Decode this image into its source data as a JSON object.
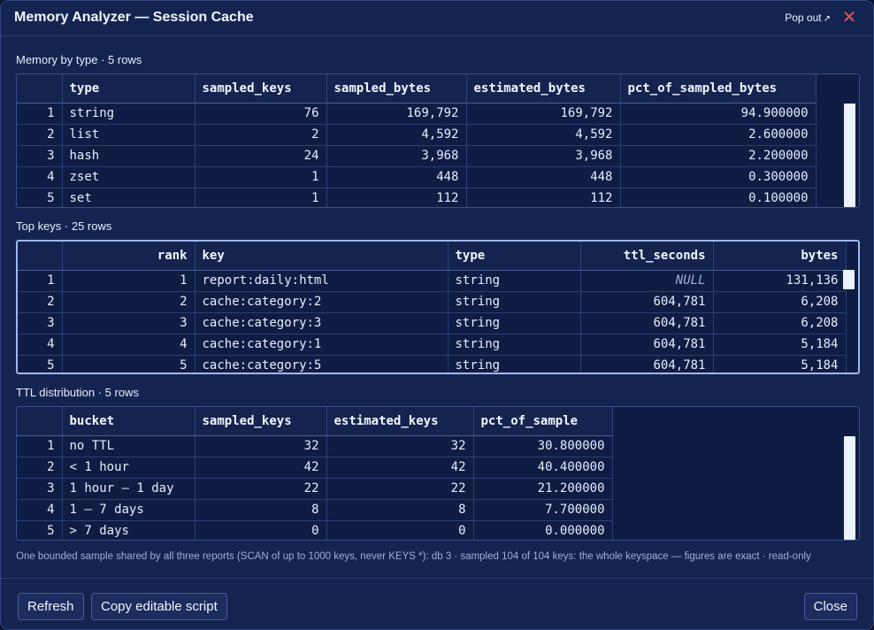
{
  "window": {
    "title": "Memory Analyzer — Session Cache",
    "popout_label": "Pop out",
    "popout_icon": "↗",
    "close_icon": "✕"
  },
  "memory_by_type": {
    "label": "Memory by type · 5 rows",
    "columns": [
      "",
      "type",
      "sampled_keys",
      "sampled_bytes",
      "estimated_bytes",
      "pct_of_sampled_bytes"
    ],
    "rows": [
      [
        "1",
        "string",
        "76",
        "169,792",
        "169,792",
        "94.900000"
      ],
      [
        "2",
        "list",
        "2",
        "4,592",
        "4,592",
        "2.600000"
      ],
      [
        "3",
        "hash",
        "24",
        "3,968",
        "3,968",
        "2.200000"
      ],
      [
        "4",
        "zset",
        "1",
        "448",
        "448",
        "0.300000"
      ],
      [
        "5",
        "set",
        "1",
        "112",
        "112",
        "0.100000"
      ]
    ]
  },
  "top_keys": {
    "label": "Top keys · 25 rows",
    "columns": [
      "",
      "rank",
      "key",
      "type",
      "ttl_seconds",
      "bytes"
    ],
    "rows": [
      [
        "1",
        "1",
        "report:daily:html",
        "string",
        "NULL",
        "131,136"
      ],
      [
        "2",
        "2",
        "cache:category:2",
        "string",
        "604,781",
        "6,208"
      ],
      [
        "3",
        "3",
        "cache:category:3",
        "string",
        "604,781",
        "6,208"
      ],
      [
        "4",
        "4",
        "cache:category:1",
        "string",
        "604,781",
        "5,184"
      ],
      [
        "5",
        "5",
        "cache:category:5",
        "string",
        "604,781",
        "5,184"
      ]
    ]
  },
  "ttl_distribution": {
    "label": "TTL distribution · 5 rows",
    "columns": [
      "",
      "bucket",
      "sampled_keys",
      "estimated_keys",
      "pct_of_sample"
    ],
    "rows": [
      [
        "1",
        "no TTL",
        "32",
        "32",
        "30.800000"
      ],
      [
        "2",
        "< 1 hour",
        "42",
        "42",
        "40.400000"
      ],
      [
        "3",
        "1 hour – 1 day",
        "22",
        "22",
        "21.200000"
      ],
      [
        "4",
        "1 – 7 days",
        "8",
        "8",
        "7.700000"
      ],
      [
        "5",
        "> 7 days",
        "0",
        "0",
        "0.000000"
      ]
    ]
  },
  "footer_note": "One bounded sample shared by all three reports (SCAN of up to 1000 keys, never KEYS *): db 3 · sampled 104 of 104 keys: the whole keyspace — figures are exact · read-only",
  "buttons": {
    "refresh": "Refresh",
    "copy_script": "Copy editable script",
    "close": "Close"
  },
  "colors": {
    "background": "#142450",
    "grid_bg": "#0f1c44",
    "active_border": "#9db9ee",
    "close_icon": "#e2555a",
    "scrollbar": "#eaf2ff"
  }
}
